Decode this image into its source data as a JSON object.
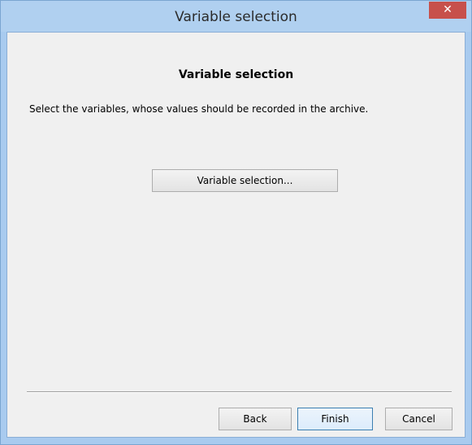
{
  "window": {
    "title": "Variable selection",
    "close_glyph": "✕"
  },
  "content": {
    "heading": "Variable selection",
    "description": "Select the variables, whose values should be recorded in the archive.",
    "variable_selection_button": "Variable selection..."
  },
  "footer": {
    "back_label": "Back",
    "finish_label": "Finish",
    "cancel_label": "Cancel"
  },
  "colors": {
    "titlebar": "#b0d0f0",
    "close_button": "#c7504b",
    "dialog_background": "#f0f0f0",
    "default_button_border": "#3c7fb1"
  }
}
